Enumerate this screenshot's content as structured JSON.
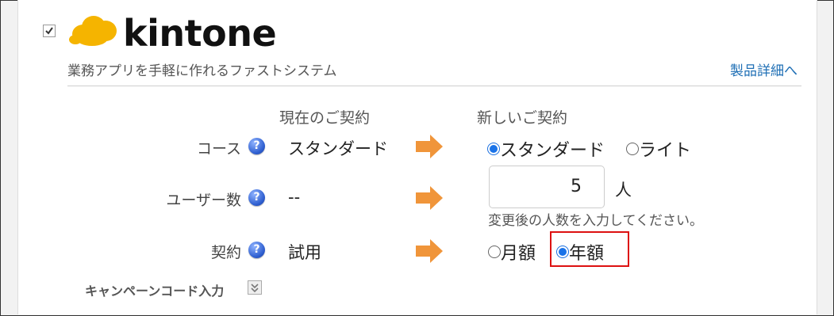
{
  "product": {
    "name": "kintone",
    "tagline": "業務アプリを手軽に作れるファストシステム",
    "detail_link": "製品詳細へ",
    "selected": true
  },
  "columns": {
    "current": "現在のご契約",
    "new": "新しいご契約"
  },
  "rows": {
    "course": {
      "label": "コース",
      "current": "スタンダード",
      "options": [
        "スタンダード",
        "ライト"
      ],
      "selected": "スタンダード"
    },
    "users": {
      "label": "ユーザー数",
      "current": "--",
      "value": "5",
      "unit": "人",
      "hint": "変更後の人数を入力してください。"
    },
    "contract": {
      "label": "契約",
      "current": "試用",
      "options": [
        "月額",
        "年額"
      ],
      "selected": "年額"
    }
  },
  "campaign": {
    "label": "キャンペーンコード入力"
  },
  "icons": {
    "help": "help-question-icon",
    "arrow": "right-arrow-icon",
    "expand": "chevron-double-down-icon"
  },
  "colors": {
    "arrow": "#f0953a",
    "link": "#1f6fb5",
    "highlight": "#dd1111",
    "logo": "#f5b400"
  }
}
